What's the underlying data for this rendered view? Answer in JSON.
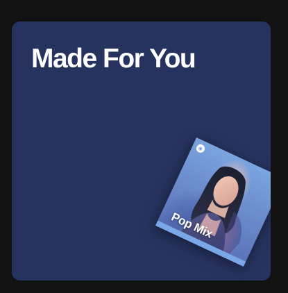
{
  "card": {
    "title": "Made For You",
    "background_color": "#27335f",
    "cover": {
      "label": "Pop Mix",
      "logo_icon": "spotify-icon",
      "accent_color": "#79a7e8"
    }
  }
}
